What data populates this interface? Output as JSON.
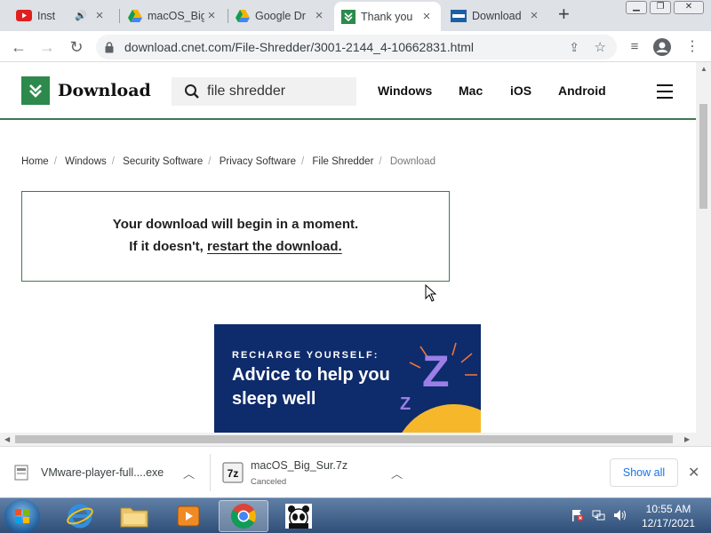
{
  "browser": {
    "tabs": [
      {
        "title": "Inst",
        "icon": "youtube-icon",
        "audio": true
      },
      {
        "title": "macOS_Big",
        "icon": "google-drive-icon"
      },
      {
        "title": "Google Dr",
        "icon": "google-drive-icon"
      },
      {
        "title": "Thank you",
        "icon": "download-site-icon",
        "active": true
      },
      {
        "title": "Download",
        "icon": "vmware-icon"
      }
    ],
    "new_tab": "+",
    "url": "download.cnet.com/File-Shredder/3001-2144_4-10662831.html"
  },
  "site": {
    "logo_text": "Download",
    "search_value": "file shredder",
    "nav": [
      "Windows",
      "Mac",
      "iOS",
      "Android"
    ],
    "breadcrumb": [
      "Home",
      "Windows",
      "Security Software",
      "Privacy Software",
      "File Shredder",
      "Download"
    ],
    "message_line1": "Your download will begin in a moment.",
    "message_line2_prefix": "If it doesn't, ",
    "message_link": "restart the download.",
    "ad_kicker": "RECHARGE YOURSELF:",
    "ad_headline": "Advice to help you sleep well",
    "ad_z_big": "Z",
    "ad_z_small": "Z"
  },
  "downloads": {
    "items": [
      {
        "name": "VMware-player-full....exe",
        "status": ""
      },
      {
        "name": "macOS_Big_Sur.7z",
        "status": "Canceled"
      }
    ],
    "show_all": "Show all"
  },
  "taskbar": {
    "time": "10:55 AM",
    "date": "12/17/2021"
  },
  "colors": {
    "brand_green": "#2d8a4c",
    "ad_background": "#0e2b6b",
    "ad_accent": "#9b7fe6",
    "link_blue": "#1a73e8"
  }
}
